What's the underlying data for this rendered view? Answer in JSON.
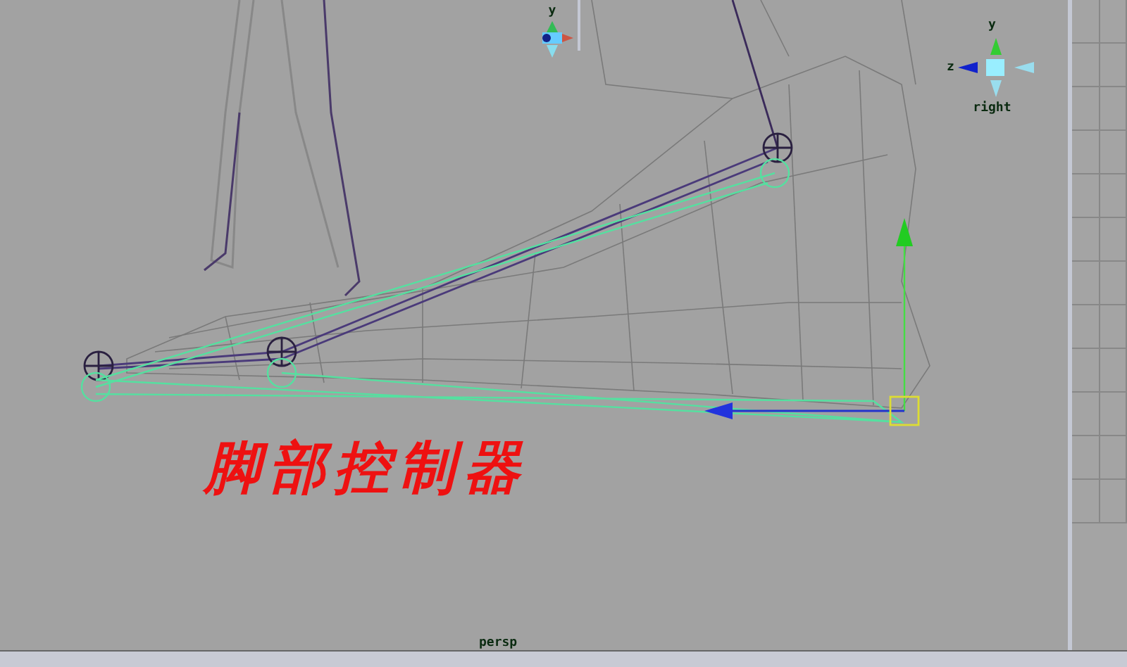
{
  "viewport": {
    "camera_label": "persp",
    "caption": "脚部控制器"
  },
  "top_gizmo": {
    "axis_label": "y"
  },
  "view_cube": {
    "view_label": "right",
    "axis_labels": [
      "y",
      "z"
    ]
  }
}
